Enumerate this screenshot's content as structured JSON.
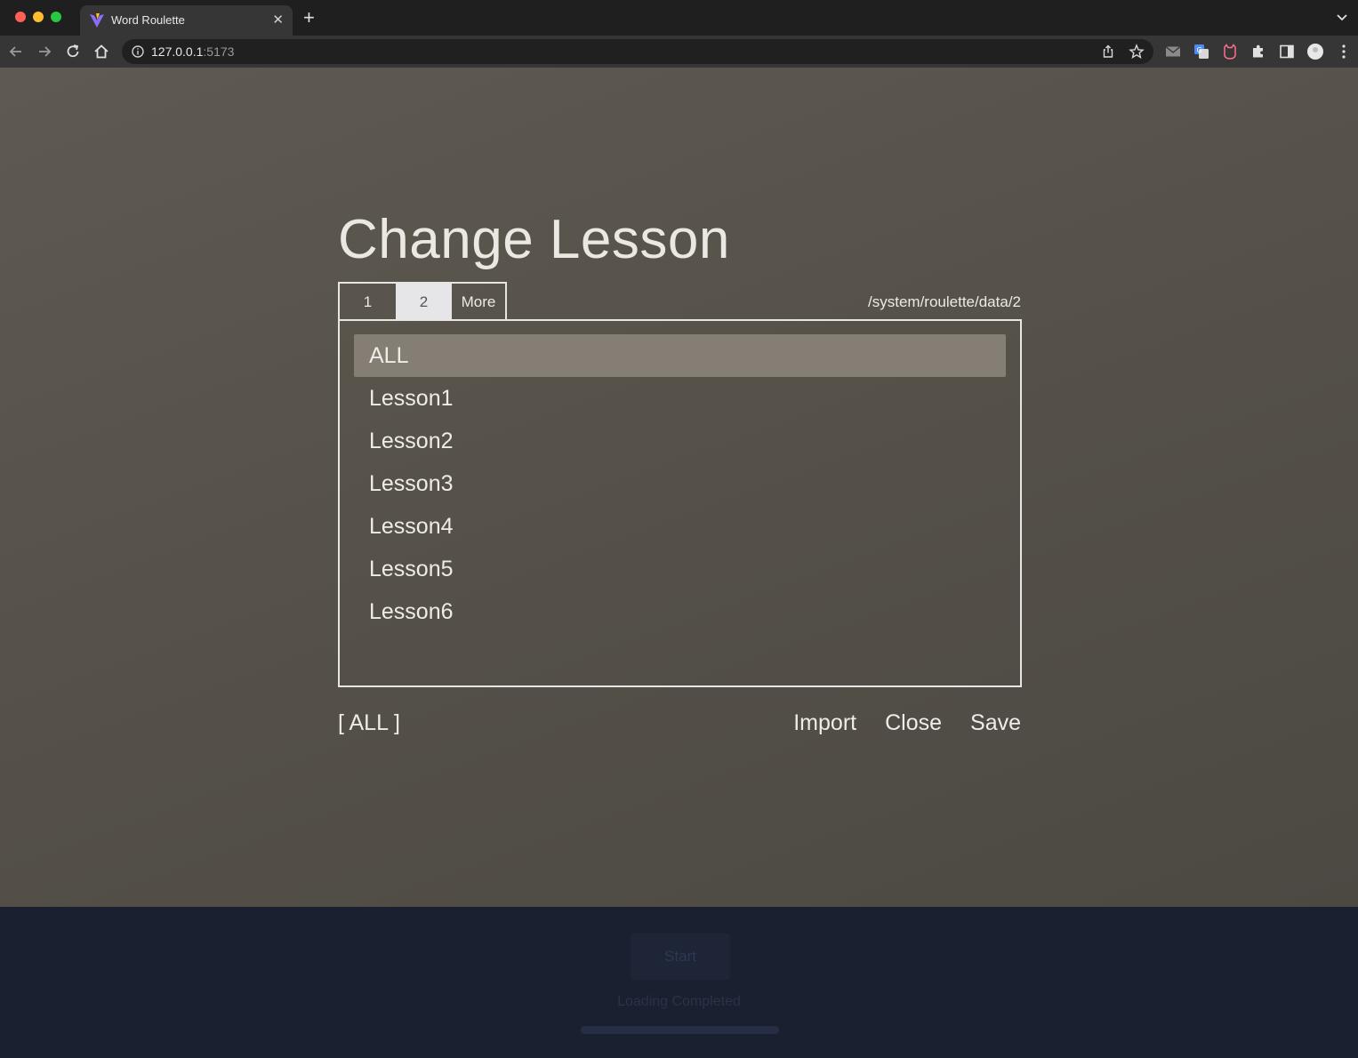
{
  "browser": {
    "tab_title": "Word Roulette",
    "url_host": "127.0.0.1",
    "url_port": ":5173"
  },
  "dialog": {
    "title": "Change Lesson",
    "tabs": [
      {
        "label": "1",
        "active": false
      },
      {
        "label": "2",
        "active": true
      },
      {
        "label": "More",
        "active": false
      }
    ],
    "path": "/system/roulette/data/2",
    "items": [
      {
        "label": "ALL",
        "selected": true
      },
      {
        "label": "Lesson1",
        "selected": false
      },
      {
        "label": "Lesson2",
        "selected": false
      },
      {
        "label": "Lesson3",
        "selected": false
      },
      {
        "label": "Lesson4",
        "selected": false
      },
      {
        "label": "Lesson5",
        "selected": false
      },
      {
        "label": "Lesson6",
        "selected": false
      }
    ],
    "selection_label": "[ ALL ]",
    "import_label": "Import",
    "close_label": "Close",
    "save_label": "Save"
  },
  "background_app": {
    "start_label": "Start",
    "status": "Loading Completed",
    "progress": 1.0
  },
  "colors": {
    "selected_row": "#857e74",
    "overlay": "#58544c",
    "app_bg": "#1a2030"
  }
}
